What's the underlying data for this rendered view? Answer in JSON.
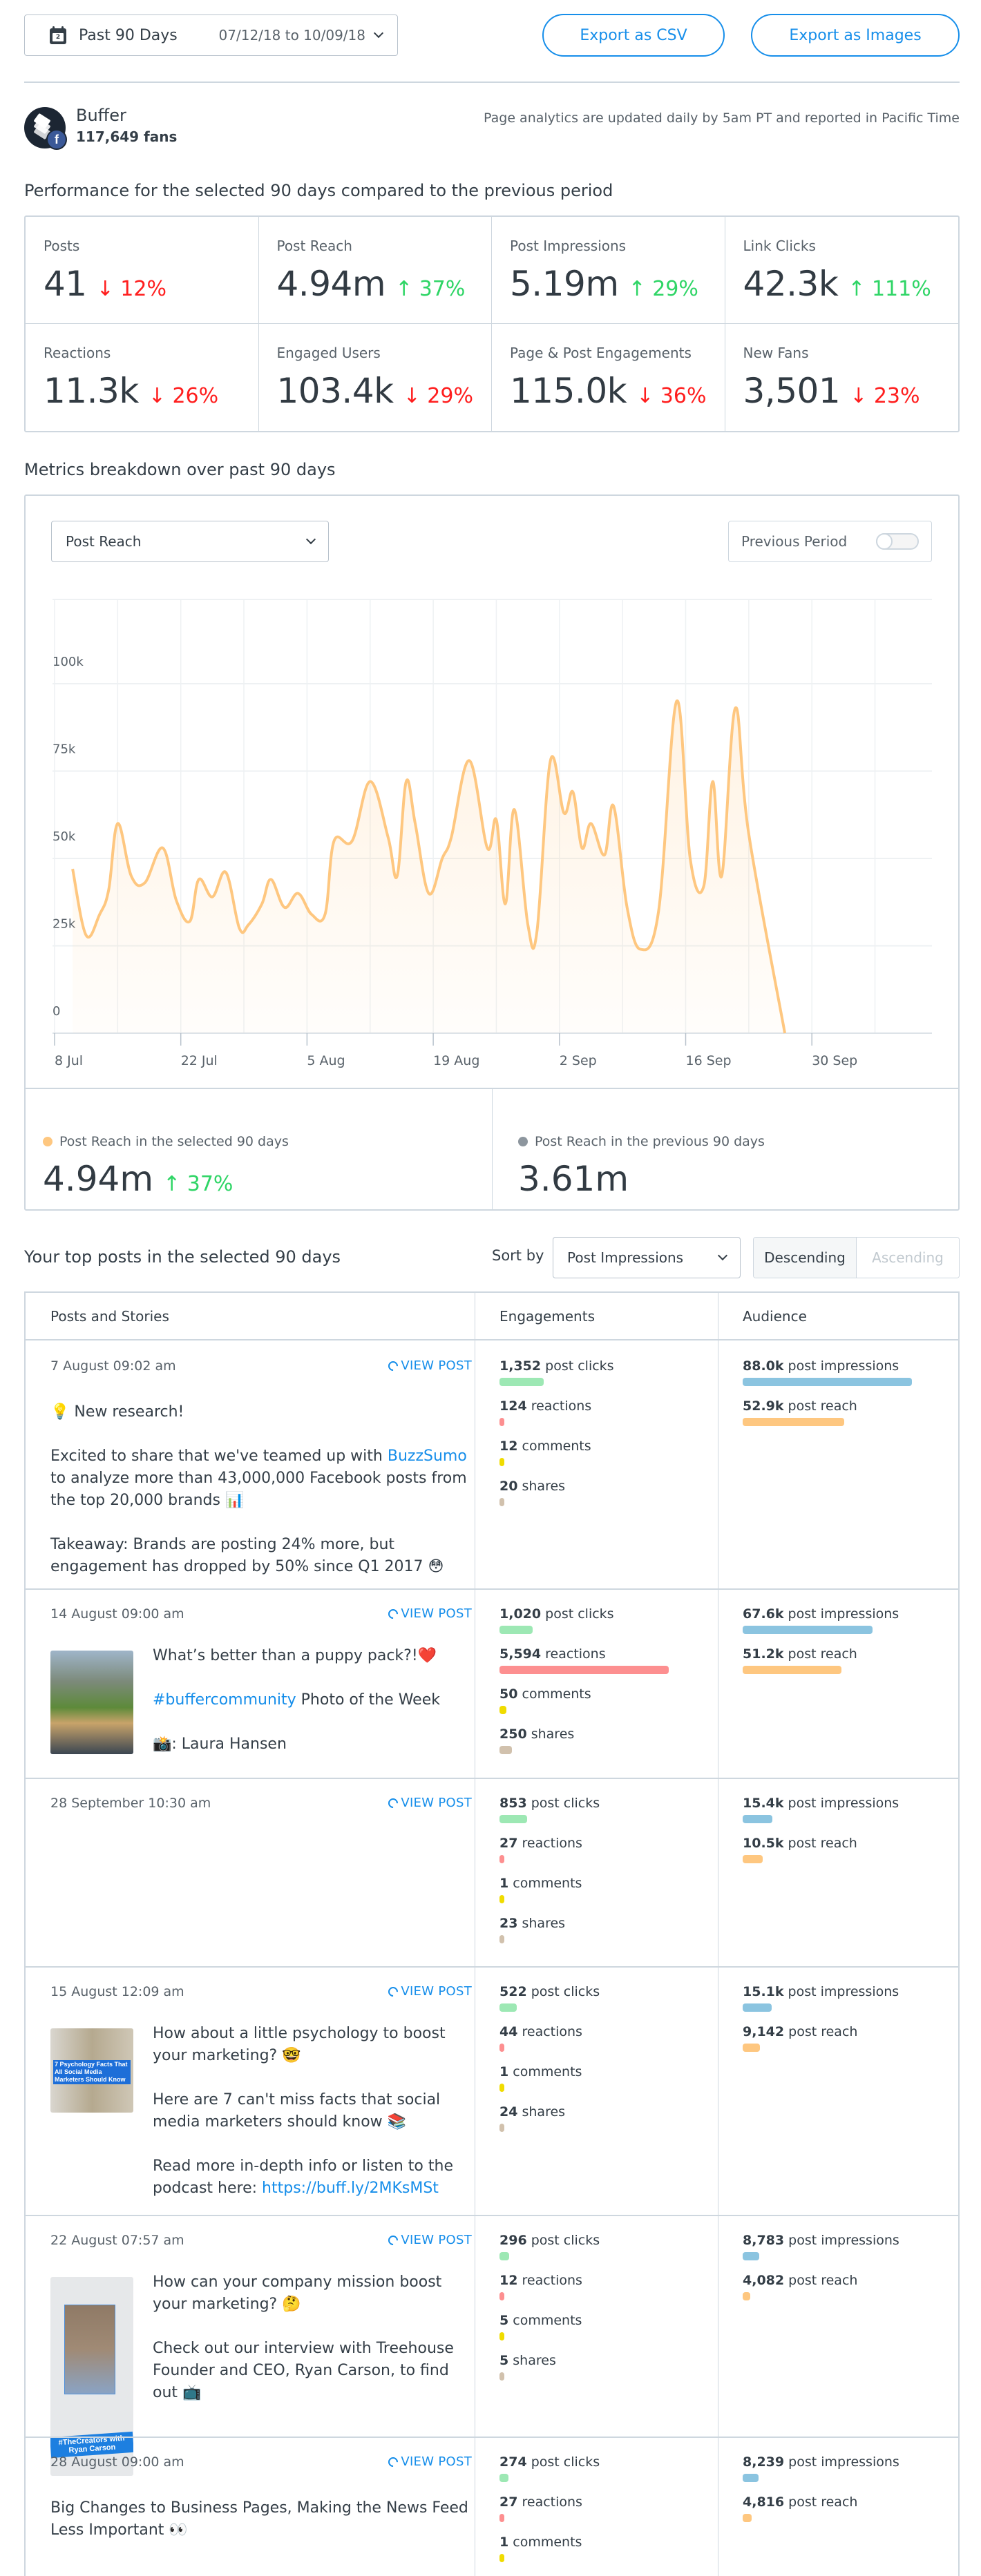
{
  "header": {
    "date_range_label": "Past 90 Days",
    "date_range_value": "07/12/18 to 10/09/18",
    "calendar_day": "2",
    "export_csv_label": "Export as CSV",
    "export_images_label": "Export as Images"
  },
  "profile": {
    "name": "Buffer",
    "fans": "117,649 fans",
    "network_badge": "f",
    "notice": "Page analytics are updated daily by 5am PT and reported in Pacific Time"
  },
  "performance": {
    "title": "Performance for the selected 90 days compared to the previous period",
    "metrics": [
      {
        "label": "Posts",
        "value": "41",
        "diff": "12%",
        "direction": "down"
      },
      {
        "label": "Post Reach",
        "value": "4.94m",
        "diff": "37%",
        "direction": "up"
      },
      {
        "label": "Post Impressions",
        "value": "5.19m",
        "diff": "29%",
        "direction": "up"
      },
      {
        "label": "Link Clicks",
        "value": "42.3k",
        "diff": "111%",
        "direction": "up"
      },
      {
        "label": "Reactions",
        "value": "11.3k",
        "diff": "26%",
        "direction": "down"
      },
      {
        "label": "Engaged Users",
        "value": "103.4k",
        "diff": "29%",
        "direction": "down"
      },
      {
        "label": "Page & Post Engagements",
        "value": "115.0k",
        "diff": "36%",
        "direction": "down"
      },
      {
        "label": "New Fans",
        "value": "3,501",
        "diff": "23%",
        "direction": "down"
      }
    ],
    "arrows": {
      "up": "↑",
      "down": "↓"
    }
  },
  "breakdown": {
    "title": "Metrics breakdown over past 90 days",
    "metric_select": "Post Reach",
    "previous_period_label": "Previous Period",
    "previous_period_on": false,
    "summary": {
      "current_label": "Post Reach in the selected 90 days",
      "current_value": "4.94m",
      "current_diff": "37%",
      "current_arrow": "↑",
      "previous_label": "Post Reach in the previous 90 days",
      "previous_value": "3.61m"
    }
  },
  "colors": {
    "accent": "#168eea",
    "up": "#2fd566",
    "down": "#ff1e1e",
    "reach_line": "#fec780",
    "previous_dot": "#8d969e",
    "post_clicks": "#9de8b4",
    "reactions": "#fd8f90",
    "comments": "#f0dc00",
    "shares": "#d1c1ad",
    "impressions": "#8bc4e0",
    "reach": "#fec780"
  },
  "chart_data": {
    "type": "area",
    "title": "Post Reach",
    "xlabel": "",
    "ylabel": "",
    "x_ticks": [
      "8 Jul",
      "22 Jul",
      "5 Aug",
      "19 Aug",
      "2 Sep",
      "16 Sep",
      "30 Sep"
    ],
    "y_ticks": [
      "0",
      "25k",
      "50k",
      "75k",
      "100k"
    ],
    "ylim": [
      0,
      100000
    ],
    "x_start": "10 Jul",
    "x_end": "9 Oct",
    "grid": true,
    "legend": "none",
    "series": [
      {
        "name": "Post Reach",
        "values": [
          47000,
          28000,
          34000,
          41000,
          60000,
          45000,
          43000,
          53000,
          38000,
          32000,
          44000,
          39000,
          46000,
          30000,
          31000,
          37000,
          44000,
          36000,
          40000,
          34000,
          34000,
          55000,
          55000,
          72000,
          56000,
          45000,
          72000,
          60000,
          40000,
          50000,
          56000,
          78000,
          53000,
          61000,
          37000,
          64000,
          31000,
          29000,
          78000,
          63000,
          69000,
          53000,
          60000,
          51000,
          65000,
          36000,
          24000,
          35000,
          95000,
          50000,
          42000,
          72000,
          45000,
          93000,
          57000,
          0
        ],
        "x_days": [
          0,
          1.5,
          3,
          4,
          5,
          6.5,
          8,
          10,
          11.5,
          13,
          14,
          15.5,
          17,
          18.5,
          19.5,
          21,
          22,
          23.5,
          25,
          26.5,
          28,
          29,
          31,
          33,
          35,
          36,
          37,
          38,
          39.5,
          41,
          42,
          44,
          46,
          47,
          48,
          49,
          50.5,
          51.5,
          53,
          54.5,
          55.5,
          56.5,
          57.5,
          59,
          60,
          61.5,
          63,
          65,
          67,
          68.5,
          70,
          71,
          72,
          73.5,
          75,
          79
        ]
      }
    ]
  },
  "top_posts": {
    "title": "Your top posts in the selected 90 days",
    "sort_by_label": "Sort by",
    "sort_select": "Post Impressions",
    "descending_label": "Descending",
    "ascending_label": "Ascending",
    "columns": [
      "Posts and Stories",
      "Engagements",
      "Audience"
    ],
    "view_post_label": "VIEW POST",
    "max": {
      "clicks": 1352,
      "reactions": 5594,
      "comments": 50,
      "shares": 250,
      "impressions": 88000,
      "reach": 88000
    },
    "posts": [
      {
        "date": "7 August 09:02 am",
        "thumbnail": "",
        "text_parts": [
          {
            "t": "💡  New research!\n\nExcited to share that we've teamed up with "
          },
          {
            "t": "BuzzSumo",
            "link": true
          },
          {
            "t": " to analyze more than 43,000,000 Facebook posts from the top 20,000 brands 📊\n\nTakeaway: Brands are posting 24% more, but engagement has dropped by 50% since Q1 2017 😳"
          }
        ],
        "engagements": [
          {
            "num": "1,352",
            "label": "post clicks",
            "value": 1352,
            "kind": "clicks"
          },
          {
            "num": "124",
            "label": "reactions",
            "value": 124,
            "kind": "reactions"
          },
          {
            "num": "12",
            "label": "comments",
            "value": 12,
            "kind": "comments"
          },
          {
            "num": "20",
            "label": "shares",
            "value": 20,
            "kind": "shares"
          }
        ],
        "audience": [
          {
            "num": "88.0k",
            "label": "post impressions",
            "value": 88000,
            "kind": "impressions"
          },
          {
            "num": "52.9k",
            "label": "post reach",
            "value": 52900,
            "kind": "reach"
          }
        ]
      },
      {
        "date": "14 August 09:00 am",
        "thumbnail": "puppy-photo",
        "text_parts": [
          {
            "t": "What’s better than a puppy pack?!❤️\n\n"
          },
          {
            "t": "#buffercommunity",
            "link": true
          },
          {
            "t": " Photo of the Week\n⠀⠀⠀⠀⠀⠀⠀⠀⠀⠀⠀⠀\n📸: Laura Hansen"
          }
        ],
        "engagements": [
          {
            "num": "1,020",
            "label": "post clicks",
            "value": 1020,
            "kind": "clicks"
          },
          {
            "num": "5,594",
            "label": "reactions",
            "value": 5594,
            "kind": "reactions"
          },
          {
            "num": "50",
            "label": "comments",
            "value": 50,
            "kind": "comments"
          },
          {
            "num": "250",
            "label": "shares",
            "value": 250,
            "kind": "shares"
          }
        ],
        "audience": [
          {
            "num": "67.6k",
            "label": "post impressions",
            "value": 67600,
            "kind": "impressions"
          },
          {
            "num": "51.2k",
            "label": "post reach",
            "value": 51200,
            "kind": "reach"
          }
        ]
      },
      {
        "date": "28 September 10:30 am",
        "thumbnail": "",
        "text_parts": [],
        "engagements": [
          {
            "num": "853",
            "label": "post clicks",
            "value": 853,
            "kind": "clicks"
          },
          {
            "num": "27",
            "label": "reactions",
            "value": 27,
            "kind": "reactions"
          },
          {
            "num": "1",
            "label": "comments",
            "value": 1,
            "kind": "comments"
          },
          {
            "num": "23",
            "label": "shares",
            "value": 23,
            "kind": "shares"
          }
        ],
        "audience": [
          {
            "num": "15.4k",
            "label": "post impressions",
            "value": 15400,
            "kind": "impressions"
          },
          {
            "num": "10.5k",
            "label": "post reach",
            "value": 10500,
            "kind": "reach"
          }
        ]
      },
      {
        "date": "15 August 12:09 am",
        "thumbnail": "psychology-facts",
        "thumbnail_caption": "7 Psychology Facts That All Social Media Marketers Should Know",
        "text_parts": [
          {
            "t": "How about a little psychology to boost your marketing? 🤓\n\nHere are 7 can't miss facts that social media marketers should know 📚\n\nRead more in-depth info or listen to the podcast here: "
          },
          {
            "t": "https://buff.ly/2MKsMSt",
            "link": true
          }
        ],
        "engagements": [
          {
            "num": "522",
            "label": "post clicks",
            "value": 522,
            "kind": "clicks"
          },
          {
            "num": "44",
            "label": "reactions",
            "value": 44,
            "kind": "reactions"
          },
          {
            "num": "1",
            "label": "comments",
            "value": 1,
            "kind": "comments"
          },
          {
            "num": "24",
            "label": "shares",
            "value": 24,
            "kind": "shares"
          }
        ],
        "audience": [
          {
            "num": "15.1k",
            "label": "post impressions",
            "value": 15100,
            "kind": "impressions"
          },
          {
            "num": "9,142",
            "label": "post reach",
            "value": 9142,
            "kind": "reach"
          }
        ]
      },
      {
        "date": "22 August 07:57 am",
        "thumbnail": "the-creators",
        "thumbnail_caption": "#TheCreators with Ryan Carson",
        "text_parts": [
          {
            "t": "How can your company mission boost your marketing? 🤔\n\nCheck out our interview with Treehouse Founder and CEO, Ryan Carson, to find out 📺"
          }
        ],
        "engagements": [
          {
            "num": "296",
            "label": "post clicks",
            "value": 296,
            "kind": "clicks"
          },
          {
            "num": "12",
            "label": "reactions",
            "value": 12,
            "kind": "reactions"
          },
          {
            "num": "5",
            "label": "comments",
            "value": 5,
            "kind": "comments"
          },
          {
            "num": "5",
            "label": "shares",
            "value": 5,
            "kind": "shares"
          }
        ],
        "audience": [
          {
            "num": "8,783",
            "label": "post impressions",
            "value": 8783,
            "kind": "impressions"
          },
          {
            "num": "4,082",
            "label": "post reach",
            "value": 4082,
            "kind": "reach"
          }
        ]
      },
      {
        "date": "28 August 09:00 am",
        "thumbnail": "",
        "text_parts": [
          {
            "t": "Big Changes to Business Pages, Making the News Feed Less Important 👀"
          }
        ],
        "engagements": [
          {
            "num": "274",
            "label": "post clicks",
            "value": 274,
            "kind": "clicks"
          },
          {
            "num": "27",
            "label": "reactions",
            "value": 27,
            "kind": "reactions"
          },
          {
            "num": "1",
            "label": "comments",
            "value": 1,
            "kind": "comments"
          }
        ],
        "audience": [
          {
            "num": "8,239",
            "label": "post impressions",
            "value": 8239,
            "kind": "impressions"
          },
          {
            "num": "4,816",
            "label": "post reach",
            "value": 4816,
            "kind": "reach"
          }
        ]
      }
    ]
  }
}
